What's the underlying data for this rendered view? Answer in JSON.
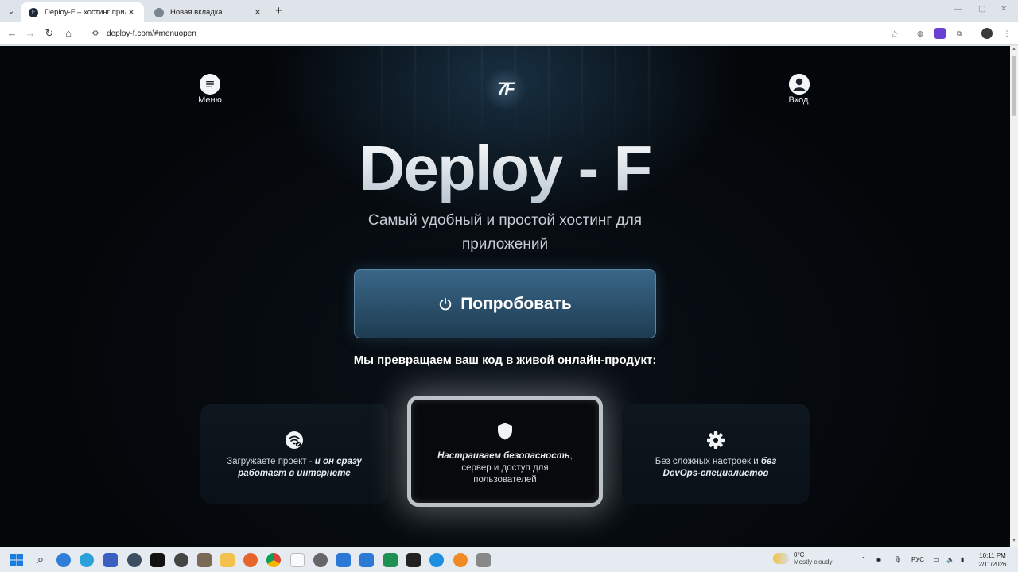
{
  "browser": {
    "tabs": [
      {
        "title": "Deploy-F – хостинг приложен",
        "active": true
      },
      {
        "title": "Новая вкладка",
        "active": false
      }
    ],
    "new_tab": "+",
    "url": "deploy-f.com/#menuopen"
  },
  "header": {
    "menu_label": "Меню",
    "login_label": "Вход",
    "logo_text": "7F"
  },
  "hero": {
    "title": "Deploy - F",
    "subtitle": "Самый удобный и простой хостинг для приложений",
    "cta_label": "Попробовать",
    "lead": "Мы превращаем ваш код в живой онлайн-продукт:"
  },
  "features": [
    {
      "icon": "wifi-check-icon",
      "text_plain": "Загружаете проект - ",
      "text_em": "и он сразу работает в интернете",
      "em_first": false
    },
    {
      "icon": "shield-icon",
      "text_em": "Настраиваем безопасность",
      "text_plain": ", сервер и доступ для пользователей",
      "em_first": true
    },
    {
      "icon": "gear-icon",
      "text_plain": "Без сложных настроек и ",
      "text_em": "без DevOps-специалистов",
      "em_first": false
    }
  ],
  "taskbar": {
    "weather_temp": "0°C",
    "weather_desc": "Mostly cloudy",
    "lang": "РУС",
    "time": "10:11 PM",
    "date": "2/11/2026"
  },
  "colors": {
    "accent": "#2c5575",
    "page_bg": "#05090d",
    "card_highlight_border": "#bcc3c8"
  }
}
